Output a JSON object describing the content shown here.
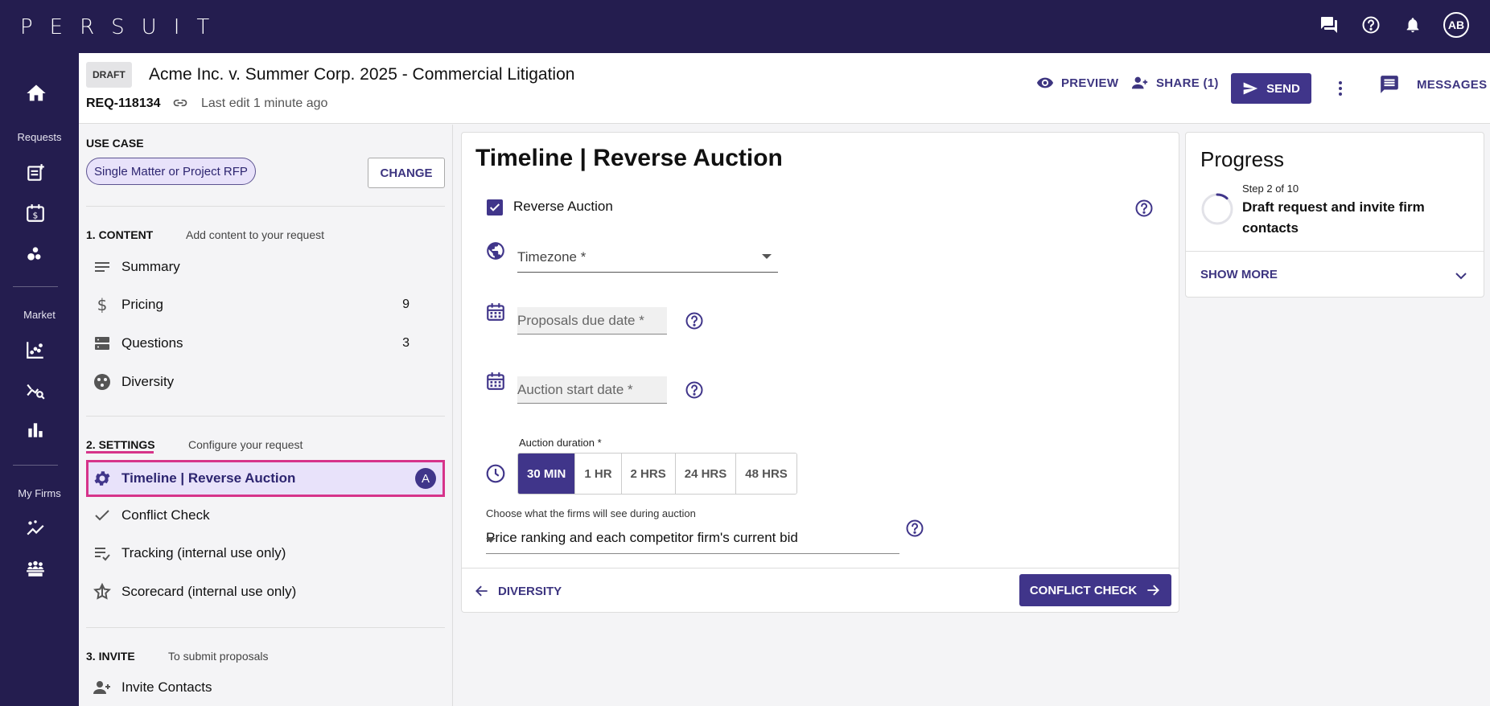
{
  "app": {
    "logo": "PERSUIT",
    "avatar_initials": "AB"
  },
  "topbar_icons": [
    "chat-icon",
    "help-icon",
    "bell-icon"
  ],
  "leftnav": {
    "sections": [
      {
        "label": "Requests",
        "items": [
          "add-request-icon",
          "calendar-dollar-icon",
          "bubbles-icon"
        ]
      },
      {
        "label": "Market",
        "items": [
          "scatter-chart-icon",
          "analytics-search-icon",
          "bar-chart-icon"
        ]
      },
      {
        "label": "My Firms",
        "items": [
          "sparkle-chart-icon",
          "groups-icon"
        ]
      }
    ]
  },
  "request": {
    "status": "DRAFT",
    "title": "Acme Inc. v. Summer Corp. 2025 - Commercial Litigation",
    "id": "REQ-118134",
    "last_edit": "Last edit 1 minute ago",
    "actions": {
      "preview": "PREVIEW",
      "share": "SHARE (1)",
      "send": "SEND",
      "messages": "MESSAGES"
    }
  },
  "sidebar": {
    "use_case_label": "USE CASE",
    "use_case_value": "Single Matter or Project RFP",
    "change_label": "CHANGE",
    "content": {
      "heading": "1. CONTENT",
      "sub": "Add content to your request",
      "items": [
        {
          "label": "Summary",
          "count": ""
        },
        {
          "label": "Pricing",
          "count": "9"
        },
        {
          "label": "Questions",
          "count": "3"
        },
        {
          "label": "Diversity",
          "count": ""
        }
      ]
    },
    "settings": {
      "heading": "2. SETTINGS",
      "sub": "Configure your request",
      "items": [
        {
          "label": "Timeline | Reverse Auction",
          "badge": "A"
        },
        {
          "label": "Conflict Check"
        },
        {
          "label": "Tracking (internal use only)"
        },
        {
          "label": "Scorecard (internal use only)"
        }
      ]
    },
    "invite": {
      "heading": "3. INVITE",
      "sub": "To submit proposals",
      "items": [
        {
          "label": "Invite Contacts"
        }
      ]
    }
  },
  "main": {
    "title": "Timeline | Reverse Auction",
    "reverse_auction_label": "Reverse Auction",
    "reverse_auction_checked": true,
    "timezone_placeholder": "Timezone *",
    "proposals_due_placeholder": "Proposals due date *",
    "auction_start_placeholder": "Auction start date *",
    "duration_label": "Auction duration *",
    "durations": [
      "30 MIN",
      "1 HR",
      "2 HRS",
      "24 HRS",
      "48 HRS"
    ],
    "selected_duration": "30 MIN",
    "visibility_label": "Choose what the firms will see during auction",
    "visibility_value": "Price ranking and each competitor firm's current bid",
    "back_label": "DIVERSITY",
    "next_label": "CONFLICT CHECK"
  },
  "progress": {
    "title": "Progress",
    "step": "Step 2 of 10",
    "step_title": "Draft request and invite firm contacts",
    "show_more": "SHOW MORE"
  },
  "colors": {
    "brand": "#241d4f",
    "accent": "#40358a",
    "highlight": "#d6338a",
    "chip_bg": "#e8e2fa"
  }
}
